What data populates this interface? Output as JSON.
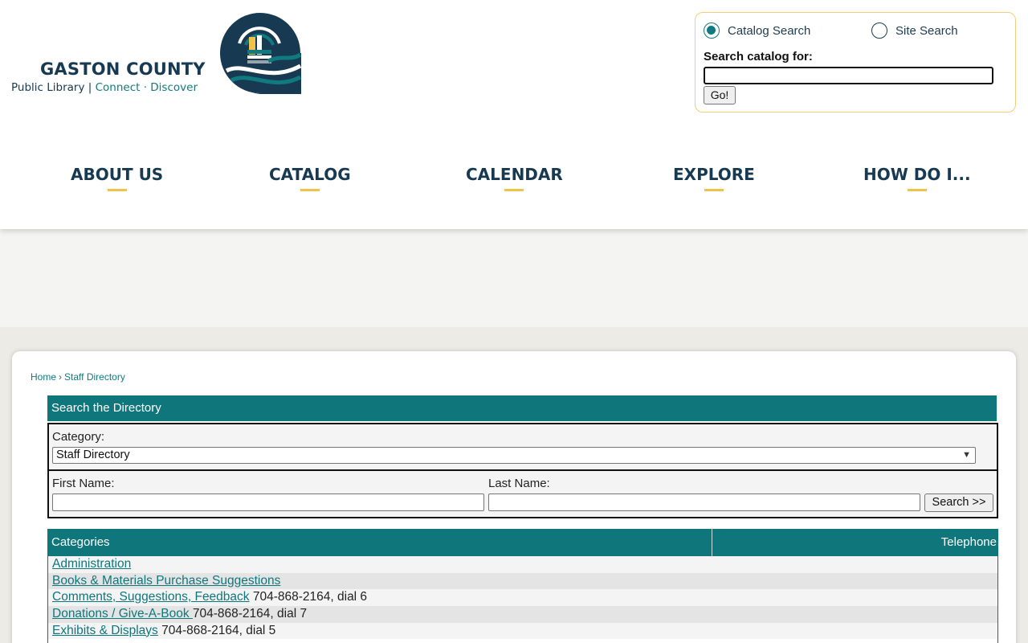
{
  "brand": {
    "name": "GASTON COUNTY",
    "tagline_part1": "Public Library",
    "tagline_sep": " | ",
    "tagline_part2": "Connect · Discover"
  },
  "catalog_search": {
    "option_catalog": "Catalog Search",
    "option_site": "Site Search",
    "selected": "Catalog Search",
    "label": "Search catalog for:",
    "value": "",
    "button": "Go!"
  },
  "nav": {
    "items": [
      "ABOUT US",
      "CATALOG",
      "CALENDAR",
      "EXPLORE",
      "HOW DO I..."
    ]
  },
  "breadcrumb": {
    "home": "Home",
    "sep": "›",
    "current": "Staff Directory"
  },
  "directory_search": {
    "heading": "Search the Directory",
    "category_label": "Category:",
    "category_value": "Staff Directory",
    "first_name_label": "First Name:",
    "last_name_label": "Last Name:",
    "first_name_value": "",
    "last_name_value": "",
    "search_button": "Search >>"
  },
  "categories_table": {
    "col_categories": "Categories",
    "col_telephone": "Telephone",
    "rows": [
      {
        "name": "Administration",
        "phone": ""
      },
      {
        "name": "Books & Materials Purchase Suggestions",
        "phone": ""
      },
      {
        "name": "Comments, Suggestions, Feedback",
        "phone": "704-868-2164, dial 6"
      },
      {
        "name": "Donations / Give-A-Book ",
        "phone": "704-868-2164, dial 7"
      },
      {
        "name": "Exhibits & Displays",
        "phone": "704-868-2164, dial 5"
      }
    ]
  },
  "colors": {
    "teal": "#0f777c",
    "navy": "#173a52",
    "gold": "#f0c24b"
  }
}
